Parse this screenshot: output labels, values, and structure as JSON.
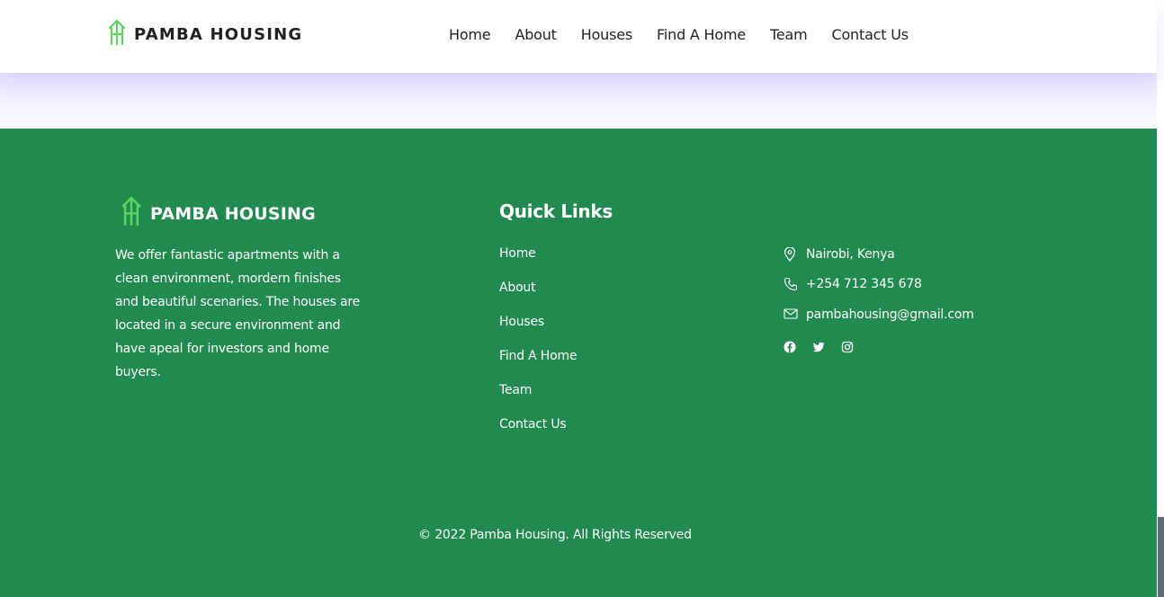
{
  "brand": {
    "name": "PAMBA HOUSING",
    "logo_icon": "house-arrow-logo-icon",
    "logo_color": "#5cd65c"
  },
  "nav": {
    "items": [
      {
        "label": "Home"
      },
      {
        "label": "About"
      },
      {
        "label": "Houses"
      },
      {
        "label": "Find A Home"
      },
      {
        "label": "Team"
      },
      {
        "label": "Contact Us"
      }
    ]
  },
  "footer": {
    "background": "#218a4e",
    "about_text": "We offer fantastic apartments with a clean environment, mordern finishes and beautiful scenaries. The houses are located in a secure environment and have apeal for investors and home buyers.",
    "quick_links": {
      "title": "Quick Links",
      "items": [
        {
          "label": "Home"
        },
        {
          "label": "About"
        },
        {
          "label": "Houses"
        },
        {
          "label": "Find A Home"
        },
        {
          "label": "Team"
        },
        {
          "label": "Contact Us"
        }
      ]
    },
    "contact": {
      "location": "Nairobi, Kenya",
      "phone": "+254 712 345 678",
      "email": "pambahousing@gmail.com"
    },
    "socials": [
      "facebook-icon",
      "twitter-icon",
      "instagram-icon"
    ],
    "copyright": "© 2022 Pamba Housing. All Rights Reserved"
  }
}
